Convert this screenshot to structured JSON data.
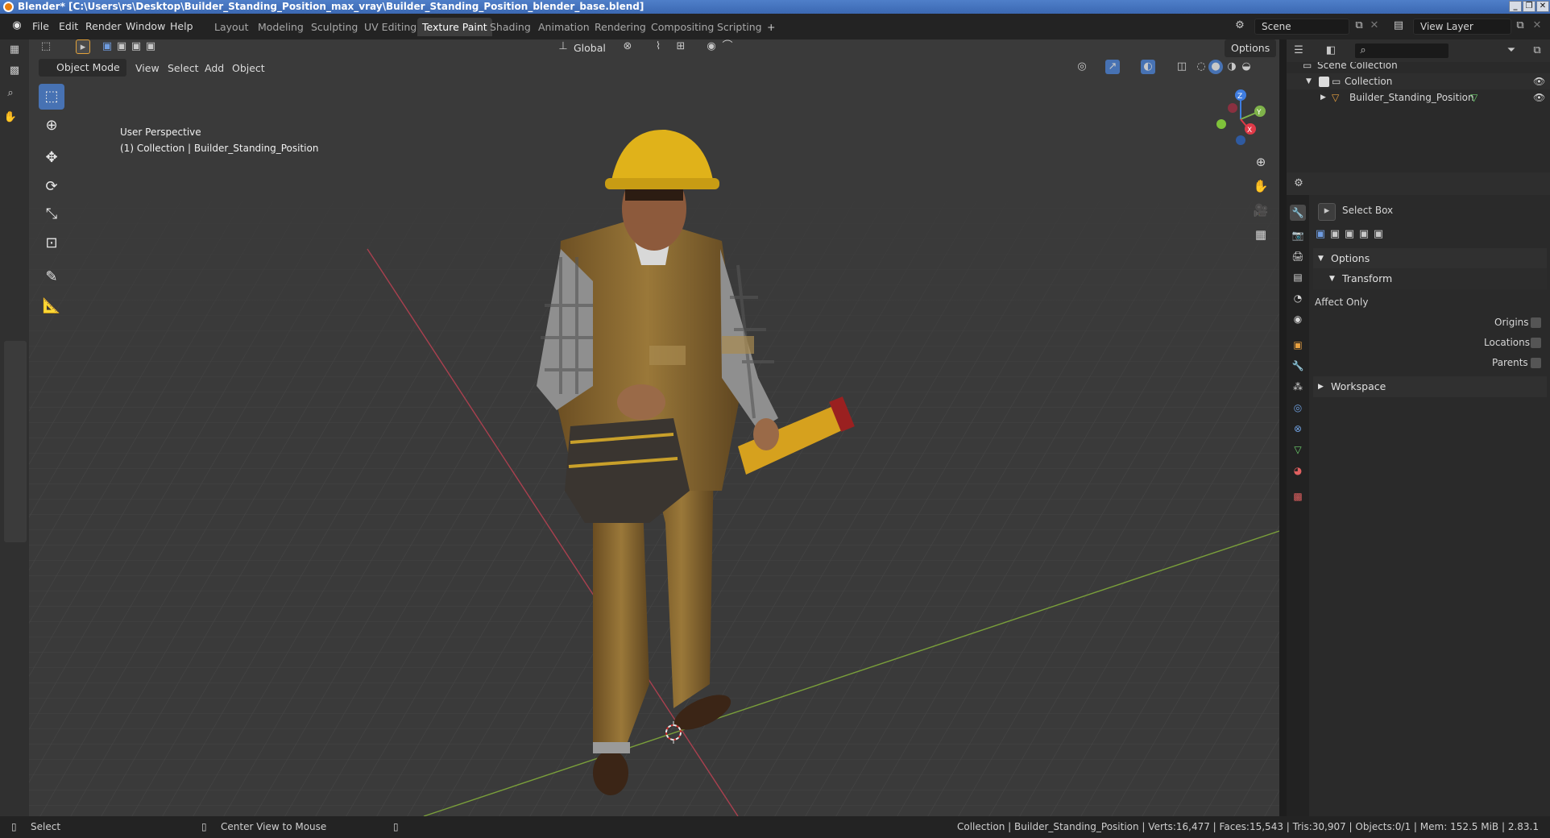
{
  "window": {
    "title": "Blender* [C:\\Users\\rs\\Desktop\\Builder_Standing_Position_max_vray\\Builder_Standing_Position_blender_base.blend]",
    "buttons": [
      "_",
      "❐",
      "✕"
    ]
  },
  "menu": [
    "File",
    "Edit",
    "Render",
    "Window",
    "Help"
  ],
  "workspaces": [
    "Layout",
    "Modeling",
    "Sculpting",
    "UV Editing",
    "Texture Paint",
    "Shading",
    "Animation",
    "Rendering",
    "Compositing",
    "Scripting"
  ],
  "active_workspace": "Texture Paint",
  "add_workspace": "+",
  "scene": {
    "value": "Scene"
  },
  "view_layer": {
    "value": "View Layer"
  },
  "viewport_header": {
    "transform_orientation": "Global",
    "options": "Options",
    "mode": "Object Mode",
    "menus": [
      "View",
      "Select",
      "Add",
      "Object"
    ]
  },
  "viewport_overlay": {
    "line1": "User Perspective",
    "line2": "(1) Collection | Builder_Standing_Position"
  },
  "gizmo": {
    "x": "X",
    "y": "Y",
    "z": "Z"
  },
  "outliner": {
    "search_placeholder": "",
    "rows": [
      {
        "label": "Scene Collection"
      },
      {
        "label": "Collection"
      },
      {
        "label": "Builder_Standing_Position"
      }
    ]
  },
  "properties": {
    "tool_name": "Select Box",
    "options": "Options",
    "transform": "Transform",
    "affect_only": "Affect Only",
    "origins": "Origins",
    "locations": "Locations",
    "parents": "Parents",
    "workspace": "Workspace"
  },
  "statusbar": {
    "left1": "Select",
    "left2": "Center View to Mouse",
    "stats": "Collection | Builder_Standing_Position | Verts:16,477 | Faces:15,543 | Tris:30,907 | Objects:0/1 | Mem: 152.5 MiB | 2.83.1"
  },
  "colors": {
    "accent": "#4772b3",
    "header": "#232323",
    "viewport": "#3a3a3a",
    "grid_x_axis": "#a9404f",
    "grid_y_axis": "#7a9f3a",
    "helmet": "#e0b21a",
    "overalls": "#8a6a33"
  }
}
